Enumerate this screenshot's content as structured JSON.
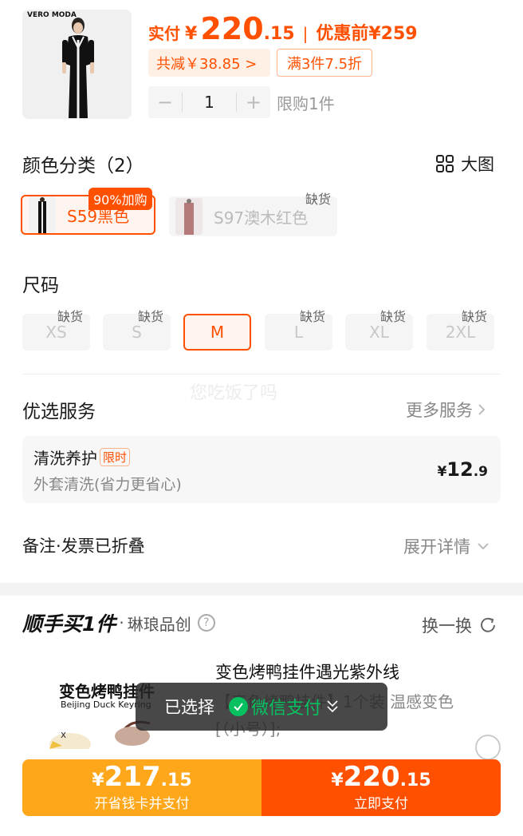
{
  "product": {
    "brand": "VERO MODA"
  },
  "price": {
    "paid_label": "实付",
    "currency": "¥",
    "int": "220",
    "dec": ".15",
    "sep": "|",
    "orig_label": "优惠前¥259"
  },
  "discounts": {
    "total": "共减￥38.85 >",
    "promo": "满3件7.5折"
  },
  "quantity": {
    "minus": "−",
    "value": "1",
    "plus": "+",
    "limit": "限购1件"
  },
  "color_section": {
    "title": "颜色分类（2）",
    "big_pic": "大图",
    "options": [
      {
        "label": "S59黑色",
        "badge": "90%加购",
        "selected": true
      },
      {
        "label": "S97澳木红色",
        "badge": "缺货",
        "selected": false
      }
    ]
  },
  "size_section": {
    "title": "尺码",
    "options": [
      {
        "label": "XS",
        "badge": "缺货"
      },
      {
        "label": "S",
        "badge": "缺货"
      },
      {
        "label": "M",
        "badge": "",
        "selected": true
      },
      {
        "label": "L",
        "badge": "缺货"
      },
      {
        "label": "XL",
        "badge": "缺货"
      },
      {
        "label": "2XL",
        "badge": "缺货"
      }
    ]
  },
  "watermark": "您吃饭了吗",
  "services": {
    "title": "优选服务",
    "more": "更多服务",
    "item": {
      "name": "清洗养护",
      "tag": "限时",
      "desc": "外套清洗(省力更省心)",
      "price_sym": "¥",
      "price_int": "12",
      "price_dec": ".9"
    }
  },
  "notes": {
    "label": "备注·发票已折叠",
    "expand": "展开详情"
  },
  "upsell": {
    "title": "顺手买1件",
    "divider": "·",
    "shop": "琳琅品创",
    "help": "?",
    "refresh": "换一换",
    "item_title": "变色烤鸭挂件遇光紫外线",
    "item_desc": "【变色烤鸭挂件】1个装 温感变色[（小号）];",
    "img_title": "变色烤鸭挂件",
    "img_sub": "Beijing Duck Keyring"
  },
  "toast": {
    "selected": "已选择",
    "method": "微信支付"
  },
  "pay": {
    "card": {
      "sym": "¥",
      "int": "217",
      "dec": ".15",
      "label": "开省钱卡并支付"
    },
    "now": {
      "sym": "¥",
      "int": "220",
      "dec": ".15",
      "label": "立即支付"
    }
  },
  "colors": {
    "accent": "#ff5000",
    "orange": "#ffa71a",
    "wechat": "#07c160"
  }
}
